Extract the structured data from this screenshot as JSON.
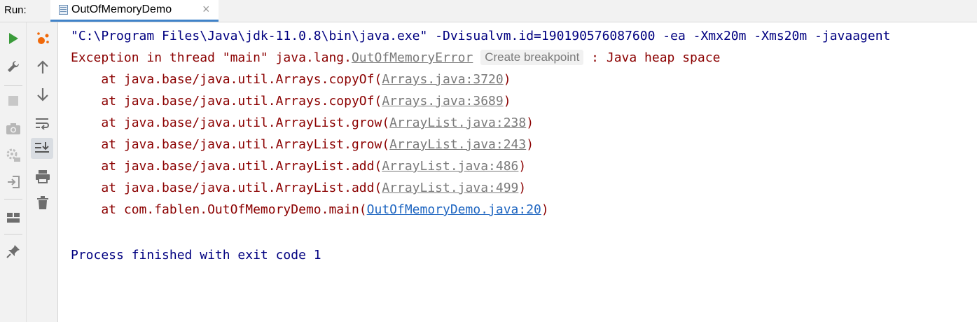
{
  "top_bar": {
    "run_label": "Run:",
    "tab_title": "OutOfMemoryDemo",
    "close_glyph": "×"
  },
  "left_toolbar": {
    "icons": [
      "rerun-icon",
      "wrench-icon",
      "stop-icon",
      "camera-icon",
      "debug-settings-icon",
      "login-icon",
      "layout-icon",
      "pin-icon"
    ]
  },
  "side_toolbar": {
    "icons": [
      "service-icon",
      "up-arrow-icon",
      "down-arrow-icon",
      "soft-wrap-icon",
      "scroll-to-end-icon",
      "print-icon",
      "trash-icon"
    ]
  },
  "console": {
    "command": "\"C:\\Program Files\\Java\\jdk-11.0.8\\bin\\java.exe\" -Dvisualvm.id=190190576087600 -ea -Xmx20m -Xms20m -javaagent",
    "exception": {
      "prefix": "Exception in thread \"main\" java.lang.",
      "class_link": "OutOfMemoryError",
      "hint": "Create breakpoint",
      "suffix": " : Java heap space"
    },
    "stack": [
      {
        "prefix": "    at java.base/java.util.Arrays.copyOf(",
        "link": "Arrays.java:3720",
        "suffix": ")"
      },
      {
        "prefix": "    at java.base/java.util.Arrays.copyOf(",
        "link": "Arrays.java:3689",
        "suffix": ")"
      },
      {
        "prefix": "    at java.base/java.util.ArrayList.grow(",
        "link": "ArrayList.java:238",
        "suffix": ")"
      },
      {
        "prefix": "    at java.base/java.util.ArrayList.grow(",
        "link": "ArrayList.java:243",
        "suffix": ")"
      },
      {
        "prefix": "    at java.base/java.util.ArrayList.add(",
        "link": "ArrayList.java:486",
        "suffix": ")"
      },
      {
        "prefix": "    at java.base/java.util.ArrayList.add(",
        "link": "ArrayList.java:499",
        "suffix": ")"
      },
      {
        "prefix": "    at com.fablen.OutOfMemoryDemo.main(",
        "link": "OutOfMemoryDemo.java:20",
        "suffix": ")"
      }
    ],
    "finished": "Process finished with exit code 1"
  },
  "colors": {
    "command": "#000080",
    "error": "#8b0000",
    "link_library": "#7a7a7a",
    "link_user": "#1f66c1",
    "tab_accent": "#4083c9",
    "rerun": "#3a9b3a",
    "service": "#f0690a"
  }
}
